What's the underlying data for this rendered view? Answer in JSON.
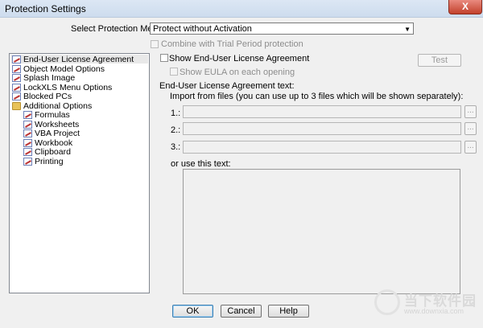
{
  "window": {
    "title": "Protection Settings",
    "close_symbol": "X"
  },
  "protection_method": {
    "label": "Select Protection Method:",
    "selected": "Protect without Activation"
  },
  "combine_trial": {
    "label": "Combine with Trial Period protection",
    "checked": false,
    "enabled": false
  },
  "tree": {
    "items": [
      {
        "label": "End-User License Agreement",
        "icon": "page-icon",
        "level": 0,
        "selected": true
      },
      {
        "label": "Object Model Options",
        "icon": "page-icon",
        "level": 0
      },
      {
        "label": "Splash Image",
        "icon": "page-icon",
        "level": 0
      },
      {
        "label": "LockXLS Menu Options",
        "icon": "page-icon",
        "level": 0
      },
      {
        "label": "Blocked PCs",
        "icon": "page-icon",
        "level": 0
      },
      {
        "label": "Additional Options",
        "icon": "folder-icon",
        "level": 0
      },
      {
        "label": "Formulas",
        "icon": "page-icon",
        "level": 1
      },
      {
        "label": "Worksheets",
        "icon": "page-icon",
        "level": 1
      },
      {
        "label": "VBA Project",
        "icon": "page-icon",
        "level": 1
      },
      {
        "label": "Workbook",
        "icon": "page-icon",
        "level": 1
      },
      {
        "label": "Clipboard",
        "icon": "page-icon",
        "level": 1
      },
      {
        "label": "Printing",
        "icon": "page-icon",
        "level": 1
      }
    ]
  },
  "eula": {
    "show_label": "Show End-User License Agreement",
    "show_checked": false,
    "show_each_label": "Show EULA on each opening",
    "test_label": "Test",
    "text_label": "End-User License Agreement text:",
    "import_label": "Import from files (you can use up to 3 files which will be shown separately):",
    "files": [
      {
        "label": "1.:",
        "value": ""
      },
      {
        "label": "2.:",
        "value": ""
      },
      {
        "label": "3.:",
        "value": ""
      }
    ],
    "browse_label": "...",
    "or_label": "or use this text:",
    "text_value": ""
  },
  "footer": {
    "ok_label": "OK",
    "cancel_label": "Cancel",
    "help_label": "Help"
  },
  "watermark": {
    "line1": "当下软件园",
    "line2": "www.downxia.com"
  }
}
